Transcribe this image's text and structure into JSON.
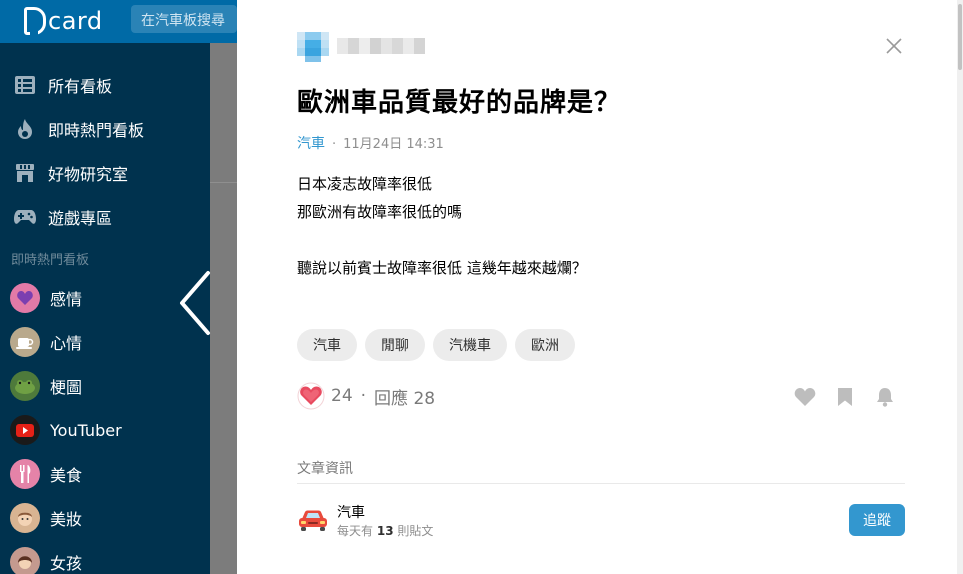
{
  "header": {
    "logo_text": "card",
    "search_placeholder": "在汽車板搜尋"
  },
  "sidebar": {
    "nav_items": [
      {
        "label": "所有看板",
        "icon": "list-icon"
      },
      {
        "label": "即時熱門看板",
        "icon": "flame-icon"
      },
      {
        "label": "好物研究室",
        "icon": "store-icon"
      },
      {
        "label": "遊戲專區",
        "icon": "gamepad-icon"
      }
    ],
    "section_label": "即時熱門看板",
    "boards": [
      {
        "label": "感情",
        "icon": "heart-avatar-icon",
        "color": "#e27aa7"
      },
      {
        "label": "心情",
        "icon": "coffee-avatar-icon",
        "color": "#b9a98c"
      },
      {
        "label": "梗圖",
        "icon": "frog-avatar-icon",
        "color": "#4e7a3b"
      },
      {
        "label": "YouTuber",
        "icon": "youtube-avatar-icon",
        "color": "#1a1a1a"
      },
      {
        "label": "美食",
        "icon": "fork-avatar-icon",
        "color": "#e583a8"
      },
      {
        "label": "美妝",
        "icon": "face-avatar-icon",
        "color": "#d8b492"
      },
      {
        "label": "女孩",
        "icon": "girl-avatar-icon",
        "color": "#c49a8f"
      }
    ]
  },
  "post": {
    "title": "歐洲車品質最好的品牌是？",
    "board": "汽車",
    "separator": "·",
    "timestamp": "11月24日 14:31",
    "body_lines": [
      "日本凌志故障率很低",
      "那歐洲有故障率很低的嗎",
      "",
      "聽說以前賓士故障率很低 這幾年越來越爛？"
    ],
    "tags": [
      "汽車",
      "閒聊",
      "汽機車",
      "歐洲"
    ],
    "like_count": "24",
    "reply_label": "回應 28"
  },
  "info": {
    "section_title": "文章資訊",
    "board_name": "汽車",
    "daily_prefix": "每天有",
    "daily_count": "13",
    "daily_suffix": "則貼文",
    "follow_label": "追蹤"
  },
  "colors": {
    "brand": "#006aa6",
    "sidebar": "#00324e",
    "accent": "#3397cf",
    "like": "#e84a5f"
  }
}
